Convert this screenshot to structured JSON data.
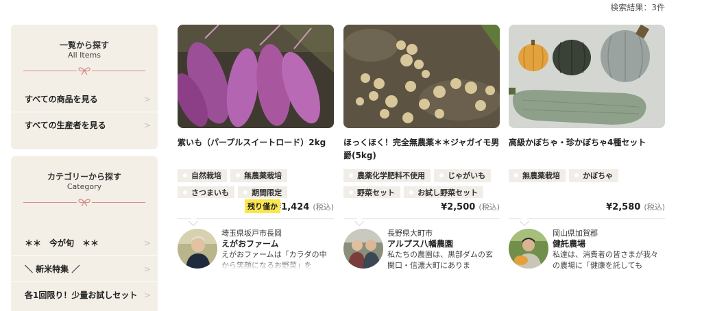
{
  "result_count": "検索結果：3件",
  "sidebar": {
    "box1": {
      "title": "一覧から探す",
      "subtitle": "All Items",
      "items": [
        {
          "label": "すべての商品を見る",
          "chev": ">"
        },
        {
          "label": "すべての生産者を見る",
          "chev": ">"
        }
      ]
    },
    "box2": {
      "title": "カテゴリーから探す",
      "subtitle": "Category",
      "items": [
        {
          "label": "＊＊　今が旬　＊＊",
          "chev": ">"
        },
        {
          "label": "＼ 新米特集 ／",
          "chev": ">"
        },
        {
          "label": "各1回限り！少量お試しセット",
          "chev": ">"
        }
      ]
    },
    "ribbon_icon": "bow-ribbon-icon"
  },
  "products": [
    {
      "title": "紫いも（パープルスイートロード）2kg",
      "tags": [
        "自然栽培",
        "無農薬栽培",
        "さつまいも",
        "期間限定"
      ],
      "badge": "残り僅か",
      "price": "¥1,424",
      "tax": "(税込)",
      "producer": {
        "location": "埼玉県坂戸市長岡",
        "name": "えがおファーム",
        "desc": "えがおファームは「カラダの中から笑顔になるお野菜」を"
      }
    },
    {
      "title": "ほっくほく！完全無農薬＊＊ジャガイモ男爵(5kg)",
      "tags": [
        "農薬化学肥料不使用",
        "じゃがいも",
        "野菜セット",
        "お試し野菜セット"
      ],
      "price": "¥2,500",
      "tax": "(税込)",
      "producer": {
        "location": "長野県大町市",
        "name": "アルプス八幡農園",
        "desc": "私たちの農園は、黒部ダムの玄関口・信濃大町にありま"
      }
    },
    {
      "title": "高級かぼちゃ・珍かぼちゃ4種セット",
      "tags": [
        "無農薬栽培",
        "かぼちゃ"
      ],
      "price": "¥2,580",
      "tax": "(税込)",
      "producer": {
        "location": "岡山県加賀郡",
        "name": "健託農場",
        "desc": "私達は、消費者の皆さまが我々の農場に「健康を託しても"
      }
    }
  ],
  "colors": {
    "sidebar_bg": "#f3efe6",
    "ribbon": "#d98a8a",
    "badge": "#fbe74d",
    "tag_bg": "#f1eee8"
  }
}
